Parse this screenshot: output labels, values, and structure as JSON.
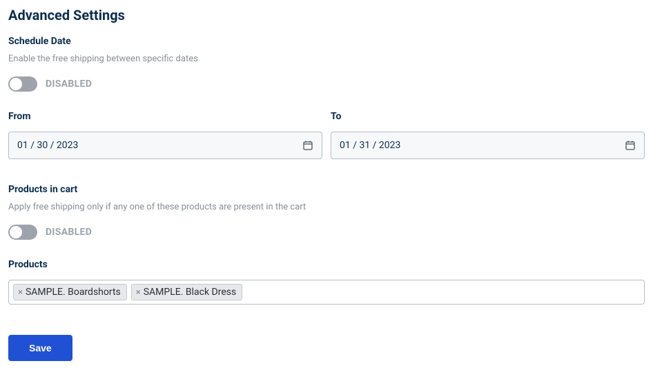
{
  "title": "Advanced Settings",
  "schedule": {
    "label": "Schedule Date",
    "helper": "Enable the free shipping between specific dates",
    "toggle_state": "DISABLED",
    "from_label": "From",
    "from_value": "01 / 30 / 2023",
    "to_label": "To",
    "to_value": "01 / 31 / 2023"
  },
  "products_cart": {
    "label": "Products in cart",
    "helper": "Apply free shipping only if any one of these products are present in the cart",
    "toggle_state": "DISABLED",
    "products_label": "Products",
    "tags": [
      "SAMPLE. Boardshorts",
      "SAMPLE. Black Dress"
    ]
  },
  "actions": {
    "save": "Save"
  },
  "colors": {
    "text_primary": "#0b2e4f",
    "text_muted": "#8a8f99",
    "toggle_off": "#9ea3ab",
    "border": "#b6bcc4",
    "tag_bg": "#e6e8eb",
    "primary_btn": "#2050d4"
  }
}
